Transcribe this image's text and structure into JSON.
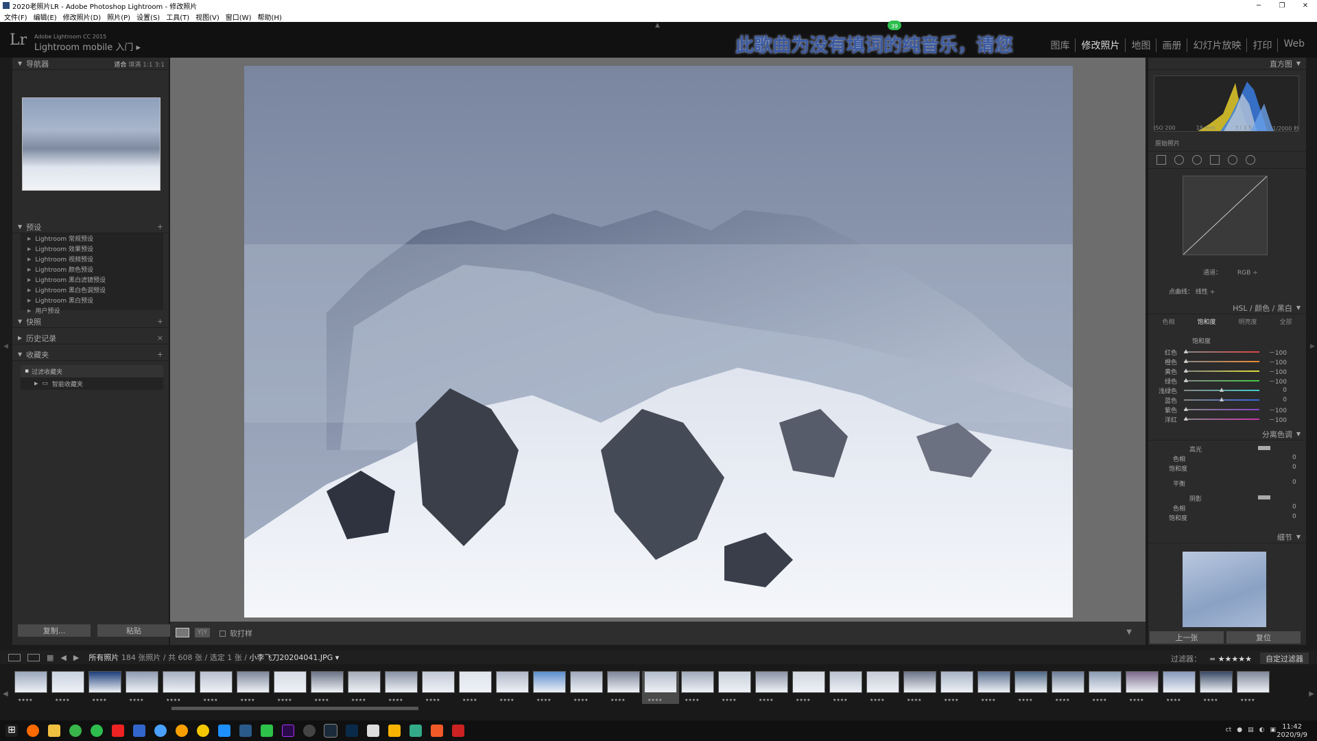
{
  "window": {
    "title": "2020老照片LR - Adobe Photoshop Lightroom - 修改照片",
    "controls": {
      "minimize": "─",
      "restore": "❐",
      "close": "✕"
    }
  },
  "menu": [
    "文件(F)",
    "编辑(E)",
    "修改照片(D)",
    "照片(P)",
    "设置(S)",
    "工具(T)",
    "视图(V)",
    "窗口(W)",
    "帮助(H)"
  ],
  "identity": {
    "logo": "Lr",
    "sub": "Adobe Lightroom CC 2015",
    "mobile": "Lightroom mobile 入门 ▸",
    "lyric": "此歌曲为没有填词的纯音乐，请您",
    "badge": "39"
  },
  "modules": [
    {
      "label": "图库",
      "active": false
    },
    {
      "label": "修改照片",
      "active": true
    },
    {
      "label": "地图",
      "active": false
    },
    {
      "label": "画册",
      "active": false
    },
    {
      "label": "幻灯片放映",
      "active": false
    },
    {
      "label": "打印",
      "active": false
    },
    {
      "label": "Web",
      "active": false
    }
  ],
  "left": {
    "navigator": {
      "title": "导航器",
      "fit": "适合",
      "fill": "填满",
      "one": "1:1",
      "three": "3:1"
    },
    "presets": {
      "title": "预设",
      "items": [
        "Lightroom 常规预设",
        "Lightroom 效果预设",
        "Lightroom 视频预设",
        "Lightroom 颜色预设",
        "Lightroom 黑白滤镜预设",
        "Lightroom 黑白色调预设",
        "Lightroom 黑白预设",
        "用户预设"
      ]
    },
    "snapshots": "快照",
    "history": "历史记录",
    "collections": {
      "title": "收藏夹",
      "items": [
        "过滤收藏夹",
        "智能收藏夹"
      ]
    },
    "copy_btn": "复制...",
    "paste_btn": "粘贴"
  },
  "toolbar": {
    "view_yy": "Y|Y",
    "softproof": "软打样"
  },
  "right": {
    "histogram": {
      "title": "直方图",
      "iso": "ISO 200",
      "focal": "18 mm",
      "aperture": "f / 3.5",
      "shutter": "1/2000 秒",
      "original": "原始照片"
    },
    "tonecurve": {
      "channel_label": "通道：",
      "channel": "RGB ÷",
      "pointcurve_label": "点曲线：",
      "pointcurve": "线性 ÷"
    },
    "hsl": {
      "header": "HSL / 颜色 / 黑白",
      "tabs": [
        {
          "label": "色相",
          "active": false
        },
        {
          "label": "饱和度",
          "active": true
        },
        {
          "label": "明亮度",
          "active": false
        },
        {
          "label": "全部",
          "active": false
        }
      ],
      "section": "饱和度",
      "sliders": [
        {
          "label": "红色",
          "value": "－100",
          "pct": 0
        },
        {
          "label": "橙色",
          "value": "－100",
          "pct": 0
        },
        {
          "label": "黄色",
          "value": "－100",
          "pct": 0
        },
        {
          "label": "绿色",
          "value": "－100",
          "pct": 0
        },
        {
          "label": "浅绿色",
          "value": "0",
          "pct": 50
        },
        {
          "label": "蓝色",
          "value": "0",
          "pct": 50
        },
        {
          "label": "紫色",
          "value": "－100",
          "pct": 0
        },
        {
          "label": "洋红",
          "value": "－100",
          "pct": 0
        }
      ]
    },
    "split": {
      "title": "分离色调",
      "highlights": "高光",
      "hue": "色相",
      "sat": "饱和度",
      "balance": "平衡",
      "shadows": "阴影",
      "hl_hue": "0",
      "hl_sat": "0",
      "balance_val": "0",
      "sh_hue": "0",
      "sh_sat": "0"
    },
    "detail": "细节",
    "prev_btn": "上一张",
    "reset_btn": "复位"
  },
  "filmstrip": {
    "source": "所有照片",
    "info": "184 张照片 / 共 608 张 / 选定 1 张 /",
    "file": "小李飞刀20204041.JPG ▾",
    "filter_label": "过滤器：",
    "stars": "= ★★★★★",
    "custom": "自定过滤器",
    "rating": "★★★★"
  },
  "taskbar": {
    "lang": "ct",
    "time": "11:42",
    "date": "2020/9/9"
  },
  "colors": {
    "accent": "#dcdcdc",
    "panel": "#2b2b2b",
    "lyric": "#3c5aa0"
  }
}
